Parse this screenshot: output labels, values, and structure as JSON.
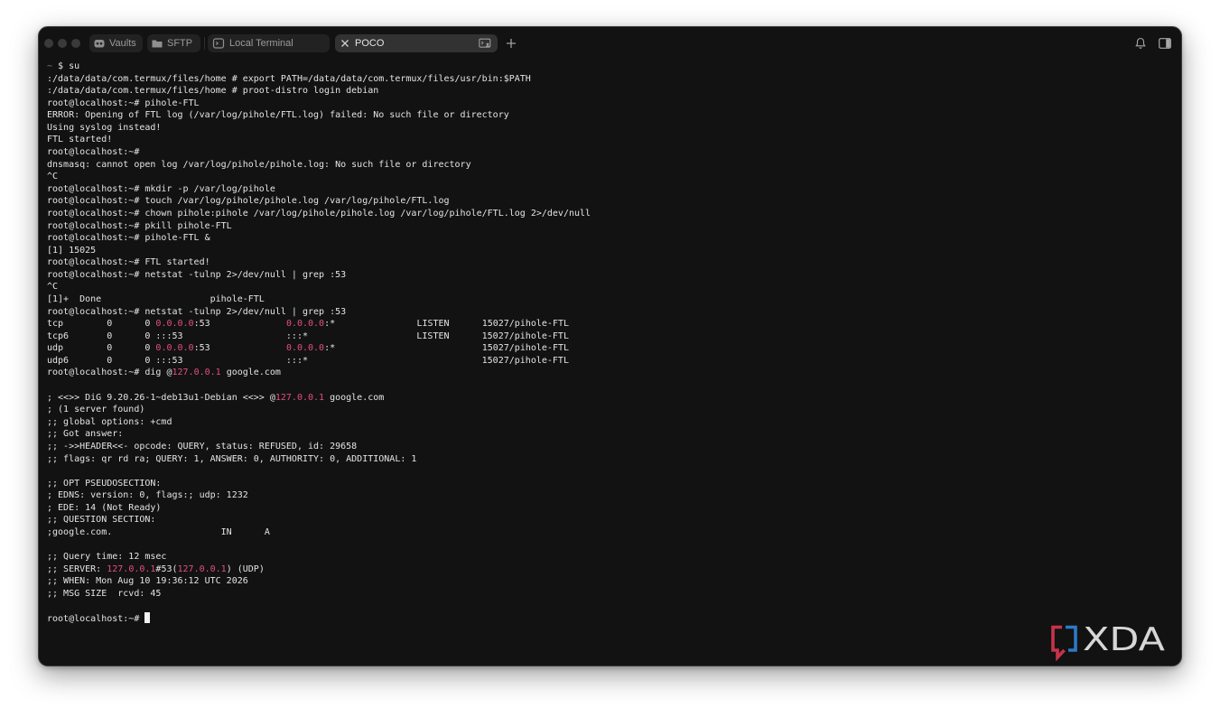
{
  "colors": {
    "background": "#121212",
    "text": "#e4e4e4",
    "ip_highlight": "#e44d86",
    "dim": "#7e7e7e",
    "cursor": "#f2f2f2"
  },
  "tabs": [
    {
      "label": "Vaults",
      "icon": "vault-icon",
      "active": false
    },
    {
      "label": "SFTP",
      "icon": "folder-icon",
      "active": false
    },
    {
      "label": "Local Terminal",
      "icon": "terminal-icon",
      "active": false
    },
    {
      "label": "POCO",
      "icon": "terminal-user-icon",
      "close_icon": "close-icon",
      "active": true
    }
  ],
  "toolbar": {
    "new_tab_icon": "plus-icon",
    "notifications_icon": "bell-icon",
    "sidebar_icon": "sidebar-toggle-icon"
  },
  "terminal": {
    "lines": [
      [
        {
          "text": "~",
          "color": "#7e7e7e"
        },
        {
          "text": " $ su"
        }
      ],
      [
        {
          "text": ":/data/data/com.termux/files/home # export PATH=/data/data/com.termux/files/usr/bin:$PATH"
        }
      ],
      [
        {
          "text": ":/data/data/com.termux/files/home # proot-distro login debian"
        }
      ],
      [
        {
          "text": "root@localhost:~# pihole-FTL"
        }
      ],
      [
        {
          "text": "ERROR: Opening of FTL log (/var/log/pihole/FTL.log) failed: No such file or directory"
        }
      ],
      [
        {
          "text": "Using syslog instead!"
        }
      ],
      [
        {
          "text": "FTL started!"
        }
      ],
      [
        {
          "text": "root@localhost:~#"
        }
      ],
      [
        {
          "text": "dnsmasq: cannot open log /var/log/pihole/pihole.log: No such file or directory"
        }
      ],
      [
        {
          "text": "^C"
        }
      ],
      [
        {
          "text": "root@localhost:~# mkdir -p /var/log/pihole"
        }
      ],
      [
        {
          "text": "root@localhost:~# touch /var/log/pihole/pihole.log /var/log/pihole/FTL.log"
        }
      ],
      [
        {
          "text": "root@localhost:~# chown pihole:pihole /var/log/pihole/pihole.log /var/log/pihole/FTL.log 2>/dev/null"
        }
      ],
      [
        {
          "text": "root@localhost:~# pkill pihole-FTL"
        }
      ],
      [
        {
          "text": "root@localhost:~# pihole-FTL &"
        }
      ],
      [
        {
          "text": "[1] 15025"
        }
      ],
      [
        {
          "text": "root@localhost:~# FTL started!"
        }
      ],
      [
        {
          "text": "root@localhost:~# netstat -tulnp 2>/dev/null | grep :53"
        }
      ],
      [
        {
          "text": "^C"
        }
      ],
      [
        {
          "text": "[1]+  Done                    pihole-FTL"
        }
      ],
      [
        {
          "text": "root@localhost:~# netstat -tulnp 2>/dev/null | grep :53"
        }
      ],
      [
        {
          "text": "tcp        0      0 "
        },
        {
          "text": "0.0.0.0",
          "color": "#e44d86"
        },
        {
          "text": ":53              "
        },
        {
          "text": "0.0.0.0",
          "color": "#e44d86"
        },
        {
          "text": ":*               LISTEN      15027/pihole-FTL"
        }
      ],
      [
        {
          "text": "tcp6       0      0 :::53                   :::*                    LISTEN      15027/pihole-FTL"
        }
      ],
      [
        {
          "text": "udp        0      0 "
        },
        {
          "text": "0.0.0.0",
          "color": "#e44d86"
        },
        {
          "text": ":53              "
        },
        {
          "text": "0.0.0.0",
          "color": "#e44d86"
        },
        {
          "text": ":*                           15027/pihole-FTL"
        }
      ],
      [
        {
          "text": "udp6       0      0 :::53                   :::*                                15027/pihole-FTL"
        }
      ],
      [
        {
          "text": "root@localhost:~# dig @"
        },
        {
          "text": "127.0.0.1",
          "color": "#e44d86"
        },
        {
          "text": " google.com"
        }
      ],
      [],
      [
        {
          "text": "; <<>> DiG 9.20.26-1~deb13u1-Debian <<>> @"
        },
        {
          "text": "127.0.0.1",
          "color": "#e44d86"
        },
        {
          "text": " google.com"
        }
      ],
      [
        {
          "text": "; (1 server found)"
        }
      ],
      [
        {
          "text": ";; global options: +cmd"
        }
      ],
      [
        {
          "text": ";; Got answer:"
        }
      ],
      [
        {
          "text": ";; ->>HEADER<<- opcode: QUERY, status: REFUSED, id: 29658"
        }
      ],
      [
        {
          "text": ";; flags: qr rd ra; QUERY: 1, ANSWER: 0, AUTHORITY: 0, ADDITIONAL: 1"
        }
      ],
      [],
      [
        {
          "text": ";; OPT PSEUDOSECTION:"
        }
      ],
      [
        {
          "text": "; EDNS: version: 0, flags:; udp: 1232"
        }
      ],
      [
        {
          "text": "; EDE: 14 (Not Ready)"
        }
      ],
      [
        {
          "text": ";; QUESTION SECTION:"
        }
      ],
      [
        {
          "text": ";google.com.                    IN      A"
        }
      ],
      [],
      [
        {
          "text": ";; Query time: 12 msec"
        }
      ],
      [
        {
          "text": ";; SERVER: "
        },
        {
          "text": "127.0.0.1",
          "color": "#e44d86"
        },
        {
          "text": "#53("
        },
        {
          "text": "127.0.0.1",
          "color": "#e44d86"
        },
        {
          "text": ") (UDP)"
        }
      ],
      [
        {
          "text": ";; WHEN: Mon Aug 10 19:36:12 UTC 2026"
        }
      ],
      [
        {
          "text": ";; MSG SIZE  rcvd: 45"
        }
      ],
      [],
      [
        {
          "text": "root@localhost:~# "
        }
      ]
    ]
  },
  "watermark": {
    "text": "XDA",
    "icon": "xda-bracket-icon"
  }
}
